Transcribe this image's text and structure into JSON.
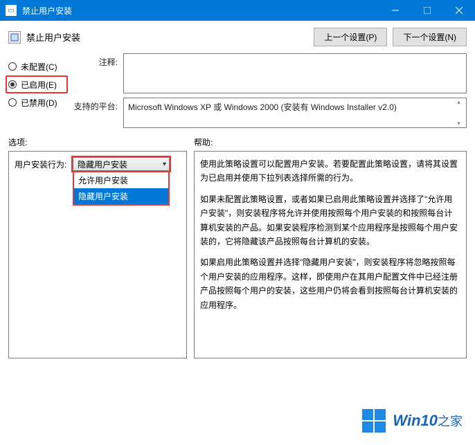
{
  "window": {
    "title": "禁止用户安装"
  },
  "header": {
    "page_title": "禁止用户安装",
    "prev_btn": "上一个设置(P)",
    "next_btn": "下一个设置(N)"
  },
  "radios": {
    "not_configured": "未配置(C)",
    "enabled": "已启用(E)",
    "disabled": "已禁用(D)"
  },
  "fields": {
    "comment_label": "注释:",
    "comment_value": "",
    "platform_label": "支持的平台:",
    "platform_value": "Microsoft Windows XP 或 Windows 2000 (安装有 Windows Installer v2.0)"
  },
  "sections": {
    "options_label": "选项:",
    "help_label": "帮助:"
  },
  "options": {
    "behavior_label": "用户安装行为:",
    "combo_selected": "隐藏用户安装",
    "dropdown": {
      "allow": "允许用户安装",
      "hide": "隐藏用户安装"
    }
  },
  "help": {
    "p1": "使用此策略设置可以配置用户安装。若要配置此策略设置，请将其设置为已启用并使用下拉列表选择所需的行为。",
    "p2": "如果未配置此策略设置，或者如果已启用此策略设置并选择了\"允许用户安装\"，则安装程序将允许并使用按照每个用户安装的和按照每台计算机安装的产品。如果安装程序检测到某个应用程序是按照每个用户安装的，它将隐藏该产品按照每台计算机的安装。",
    "p3": "如果启用此策略设置并选择\"隐藏用户安装\"，则安装程序将忽略按照每个用户安装的应用程序。这样，即使用户在其用户配置文件中已经注册产品按照每个用户的安装，这些用户仍将会看到按照每台计算机安装的应用程序。"
  },
  "watermark": {
    "brand": "Win10",
    "suffix": "之家"
  }
}
